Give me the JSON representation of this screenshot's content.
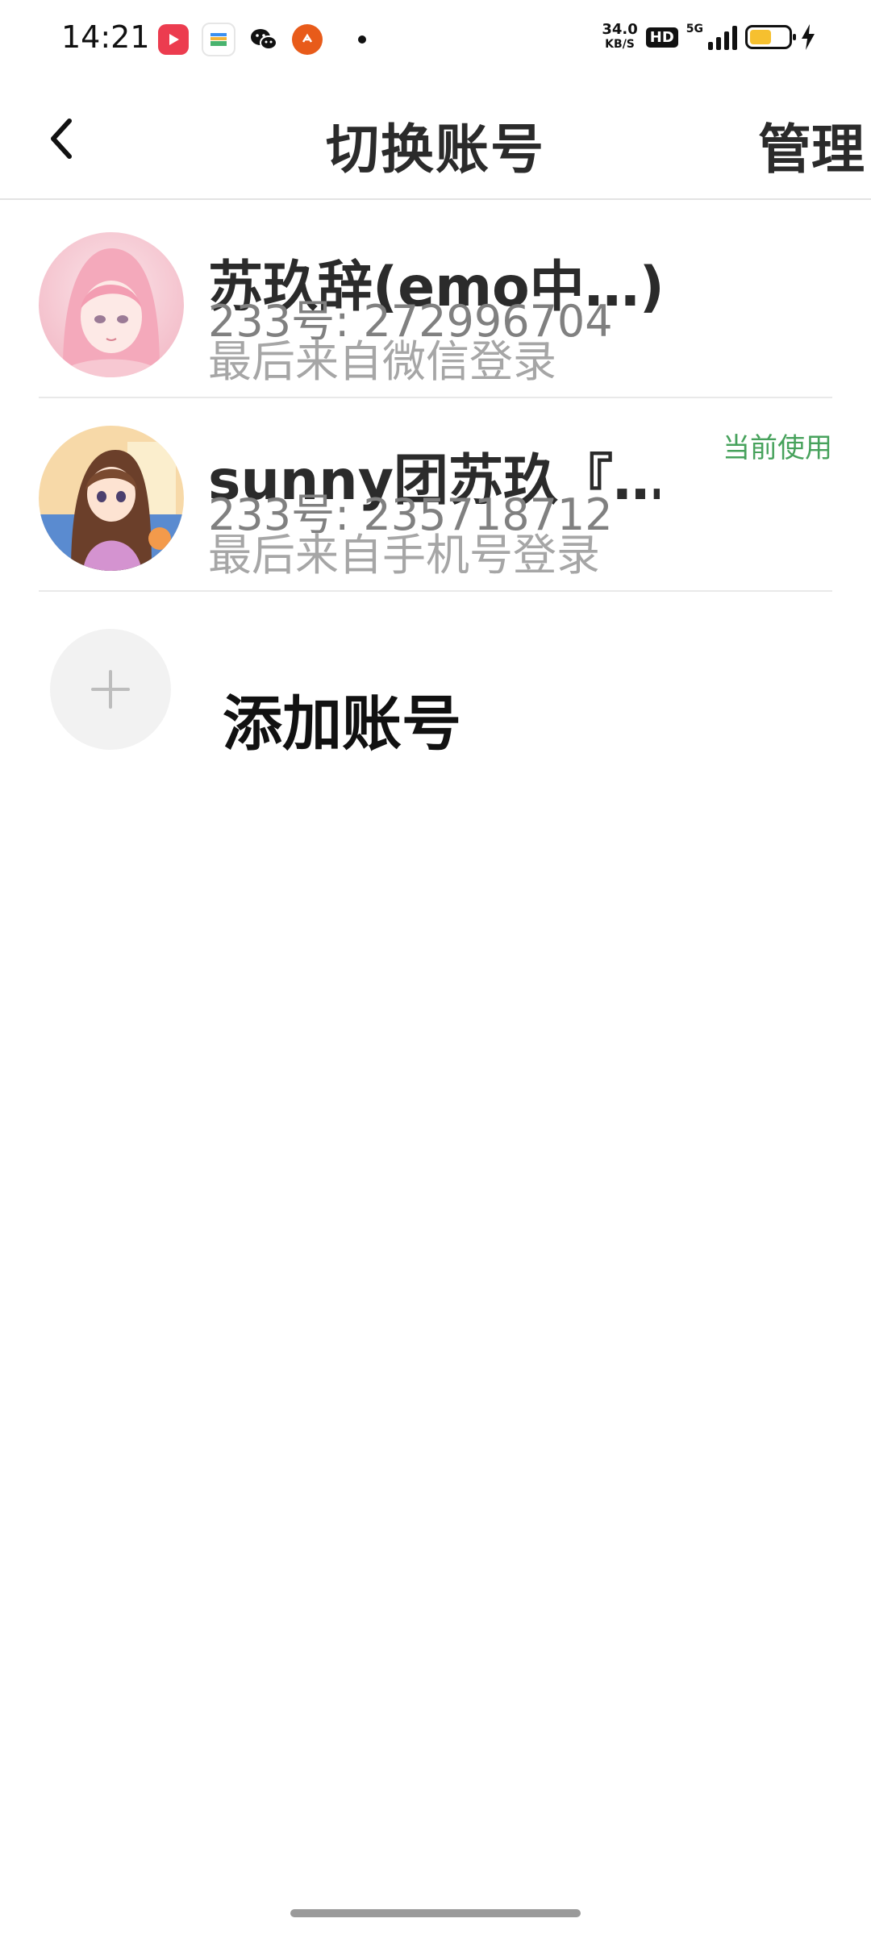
{
  "status_bar": {
    "time": "14:21",
    "net_speed": "34.0",
    "net_unit": "KB/S",
    "hd": "HD",
    "network": "5G",
    "battery_level": 0.56,
    "app_icons": [
      "video-app-icon",
      "wallet-app-icon",
      "wechat-icon",
      "orange-app-icon"
    ]
  },
  "header": {
    "title": "切换账号",
    "manage_label": "管理"
  },
  "accounts": [
    {
      "name": "苏玖辞(emo中…)",
      "id_line": "233号: 272996704",
      "source": "最后来自微信登录",
      "current": ""
    },
    {
      "name": "sunny团苏玖『…",
      "id_line": "233号: 235718712",
      "source": "最后来自手机号登录",
      "current": "当前使用"
    }
  ],
  "add_account": {
    "label": "添加账号"
  },
  "colors": {
    "accent_green": "#47a25c",
    "battery": "#f6c02f"
  }
}
